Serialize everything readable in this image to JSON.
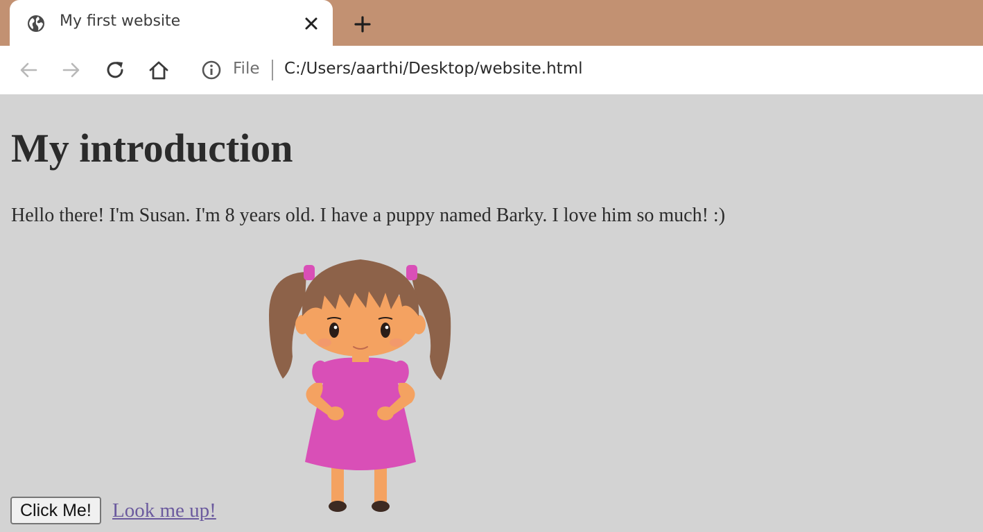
{
  "browser": {
    "tab": {
      "title": "My first website",
      "icon": "globe-icon"
    },
    "toolbar": {
      "back_icon": "back-arrow-icon",
      "forward_icon": "forward-arrow-icon",
      "reload_icon": "reload-icon",
      "home_icon": "home-icon",
      "scheme_label": "File",
      "url": "C:/Users/aarthi/Desktop/website.html"
    },
    "colors": {
      "tab_strip": "#c29172",
      "page_background": "#d3d3d3",
      "link": "#6b5a9e"
    }
  },
  "page": {
    "heading": "My introduction",
    "intro": "Hello there! I'm Susan. I'm 8 years old. I have a puppy named Barky. I love him so much! :)",
    "image_subject": "cartoon-girl-illustration",
    "button_label": "Click Me!",
    "link_label": "Look me up!"
  }
}
